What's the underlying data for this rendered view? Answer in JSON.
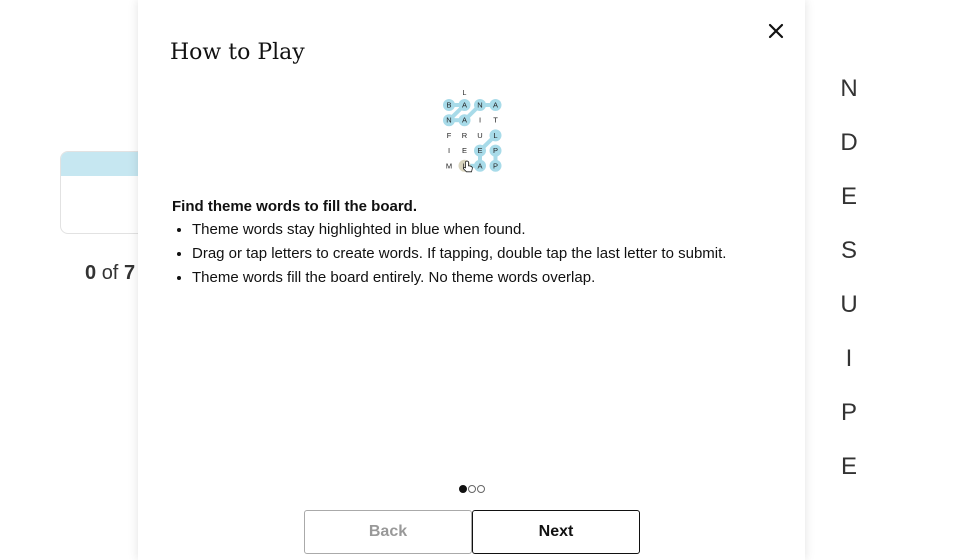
{
  "background": {
    "progress_count": "0",
    "progress_of": "of",
    "progress_total": "7",
    "letters": [
      "N",
      "D",
      "E",
      "S",
      "U",
      "I",
      "P",
      "E"
    ]
  },
  "modal": {
    "title": "How to Play",
    "close_icon": "close-icon",
    "board": {
      "top_letter": "L",
      "rows": [
        [
          "B",
          "A",
          "N",
          "A"
        ],
        [
          "N",
          "A",
          "I",
          "T"
        ],
        [
          "F",
          "R",
          "U",
          "L"
        ],
        [
          "I",
          "E",
          "E",
          "P"
        ],
        [
          "M",
          "L",
          "A",
          "P"
        ]
      ],
      "found": [
        [
          0,
          0
        ],
        [
          0,
          1
        ],
        [
          0,
          2
        ],
        [
          0,
          3
        ],
        [
          1,
          0
        ],
        [
          1,
          1
        ],
        [
          2,
          3
        ],
        [
          3,
          2
        ],
        [
          3,
          3
        ],
        [
          4,
          2
        ],
        [
          4,
          3
        ]
      ],
      "selected": [
        [
          4,
          1
        ]
      ],
      "found_color": "#a8dbe9",
      "selected_color": "#d9d4bd",
      "cursor_icon": "hand-pointer-icon"
    },
    "lead": "Find theme words to fill the board.",
    "bullets": [
      "Theme words stay highlighted in blue when found.",
      "Drag or tap letters to create words. If tapping, double tap the last letter to submit.",
      "Theme words fill the board entirely. No theme words overlap."
    ],
    "page_indicator": {
      "current": 1,
      "total": 3
    },
    "back_label": "Back",
    "next_label": "Next"
  }
}
